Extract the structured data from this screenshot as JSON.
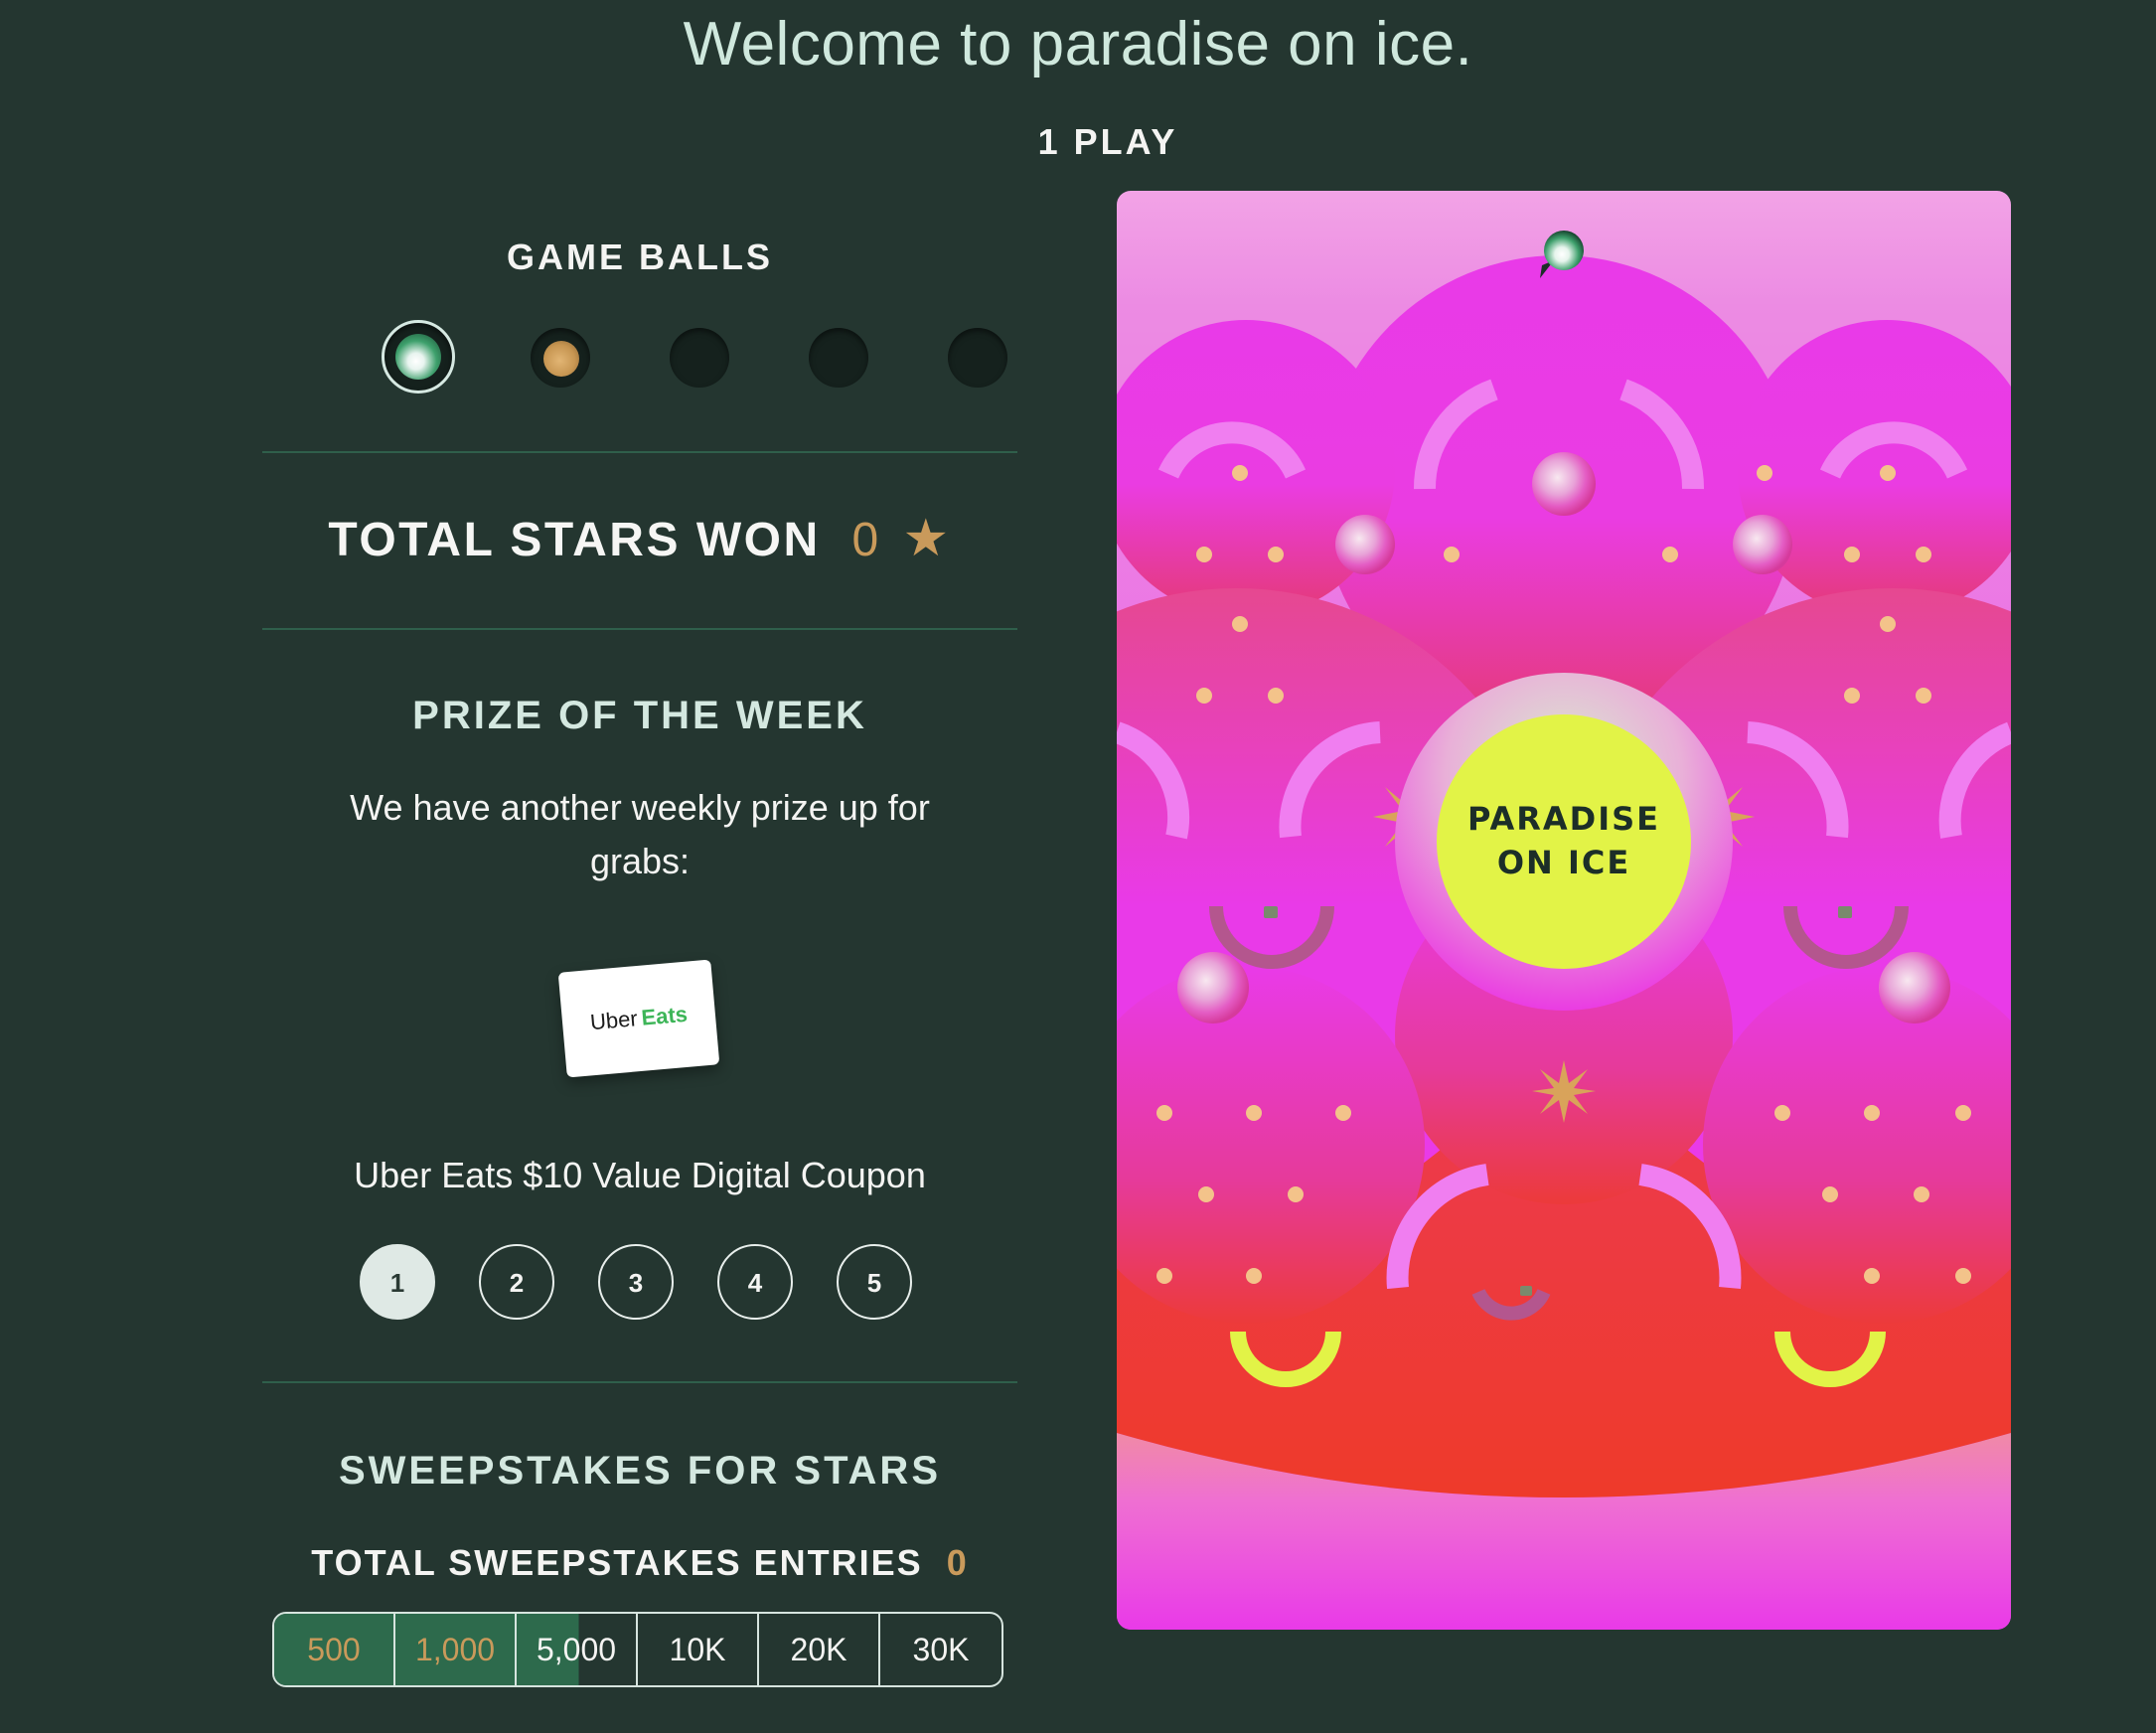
{
  "headline": "Welcome to paradise on ice.",
  "plays_label": "1 PLAY",
  "game_balls": {
    "title": "GAME BALLS",
    "slots": [
      "green-ball-active",
      "gold-ball",
      "empty",
      "empty",
      "empty"
    ]
  },
  "stars": {
    "label": "TOTAL STARS WON",
    "count": "0",
    "star_glyph": "★"
  },
  "prize": {
    "title": "PRIZE OF THE WEEK",
    "description": "We have another weekly prize up for grabs:",
    "card_brand": "Uber",
    "card_brand_accent": "Eats",
    "name": "Uber Eats $10 Value Digital Coupon",
    "pages": [
      "1",
      "2",
      "3",
      "4",
      "5"
    ],
    "active_page": "1"
  },
  "sweepstakes": {
    "title": "SWEEPSTAKES FOR STARS",
    "entries_label": "TOTAL SWEEPSTAKES ENTRIES",
    "entries_count": "0",
    "tiers": [
      "500",
      "1,000",
      "5,000",
      "10K",
      "20K",
      "30K"
    ]
  },
  "board": {
    "center_label_line1": "PARADISE",
    "center_label_line2": "ON ICE"
  },
  "colors": {
    "background": "#243630",
    "accent_gold": "#c99a5b",
    "progress_green": "#2d6a4c",
    "board_magenta": "#e93ae8",
    "board_red": "#ee3a2a",
    "center_yellow": "#e2f347"
  }
}
